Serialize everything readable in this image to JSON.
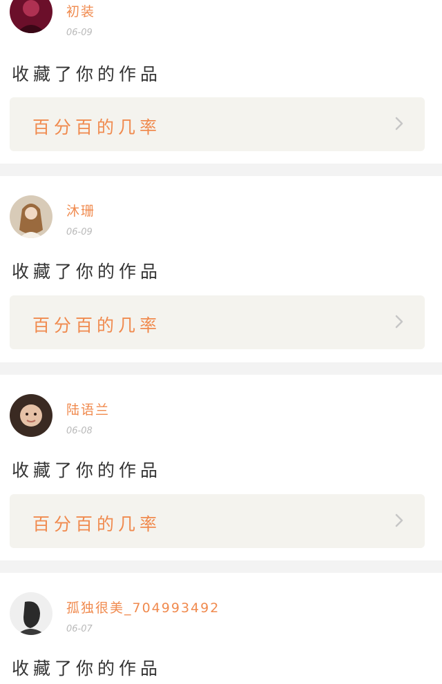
{
  "feed": [
    {
      "username": "初装",
      "date": "06-09",
      "action": "收藏了你的作品",
      "work_title": "百分百的几率",
      "avatar_colors": {
        "bg": "#6b0f2a",
        "fg": "#c0395d"
      }
    },
    {
      "username": "沐珊",
      "date": "06-09",
      "action": "收藏了你的作品",
      "work_title": "百分百的几率",
      "avatar_colors": {
        "bg": "#d8cbb8",
        "fg": "#9a6a3e"
      }
    },
    {
      "username": "陆语兰",
      "date": "06-08",
      "action": "收藏了你的作品",
      "work_title": "百分百的几率",
      "avatar_colors": {
        "bg": "#3a2a22",
        "fg": "#e6c2a7"
      }
    },
    {
      "username": "孤独很美_704993492",
      "date": "06-07",
      "action": "收藏了你的作品",
      "avatar_colors": {
        "bg": "#efefef",
        "fg": "#2a2a2a"
      }
    }
  ],
  "colors": {
    "accent": "#f08a4e",
    "date": "#b9b9b9",
    "link_bg": "#f4f3ee",
    "chevron": "#c6c6c6",
    "separator_bg": "#f3f3f3"
  },
  "icons": {
    "chevron": "chevron-right-icon"
  }
}
